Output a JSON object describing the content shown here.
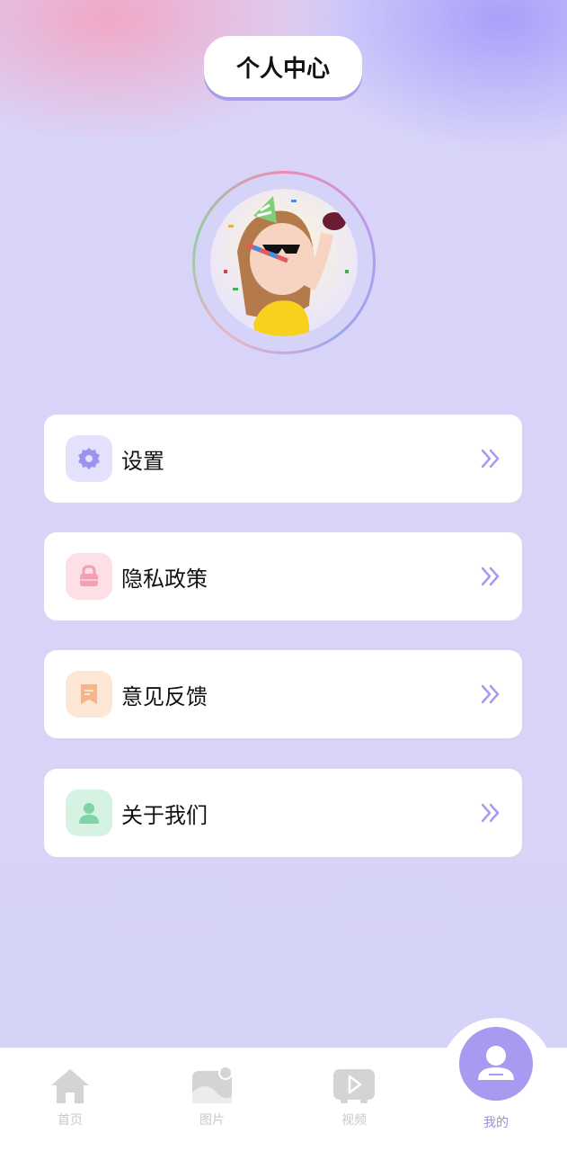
{
  "header": {
    "title": "个人中心"
  },
  "menu": [
    {
      "label": "设置",
      "icon": "gear-icon",
      "icon_bg": "#e3e1fb",
      "icon_color": "#9d93ee"
    },
    {
      "label": "隐私政策",
      "icon": "lock-icon",
      "icon_bg": "#fde0e6",
      "icon_color": "#f4a0b4"
    },
    {
      "label": "意见反馈",
      "icon": "feedback-icon",
      "icon_bg": "#fde6d4",
      "icon_color": "#f5b48a"
    },
    {
      "label": "关于我们",
      "icon": "user-icon",
      "icon_bg": "#d5f2e2",
      "icon_color": "#7fd3a6"
    }
  ],
  "tabbar": {
    "items": [
      {
        "label": "首页",
        "icon": "home-icon",
        "active": false
      },
      {
        "label": "图片",
        "icon": "image-icon",
        "active": false
      },
      {
        "label": "视频",
        "icon": "video-icon",
        "active": false
      },
      {
        "label": "我的",
        "icon": "profile-icon",
        "active": true
      }
    ]
  },
  "colors": {
    "accent": "#a79af0",
    "background": "#d6d3f8",
    "chevron": "#a79af0"
  }
}
